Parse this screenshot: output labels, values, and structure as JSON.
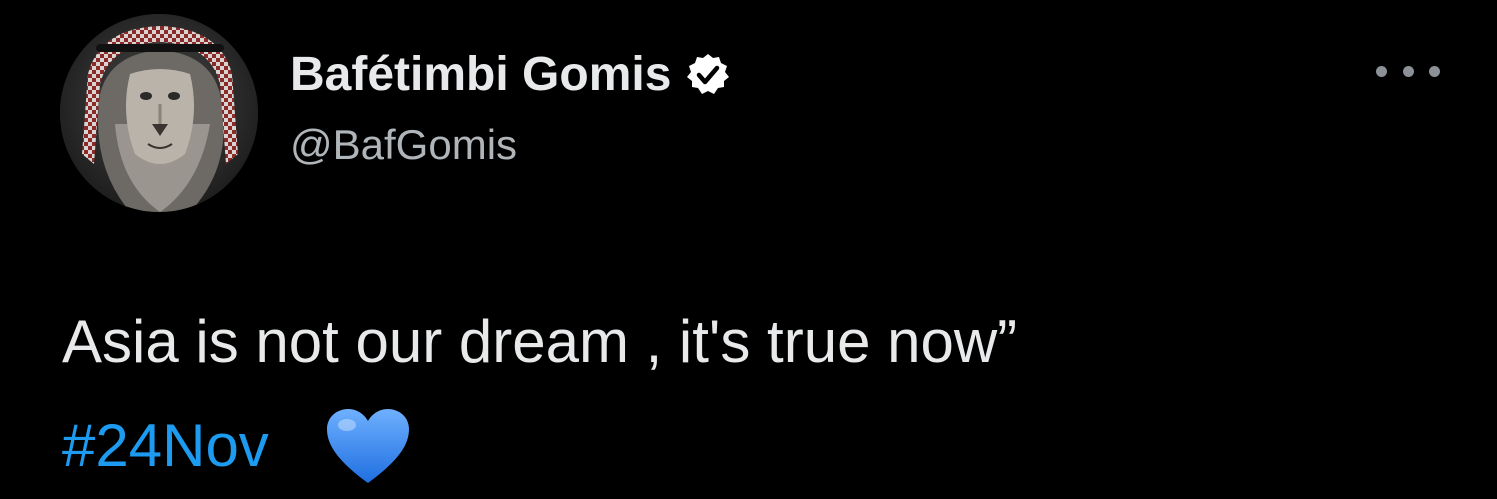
{
  "author": {
    "display_name": "Bafétimbi Gomis",
    "handle": "@BafGomis",
    "verified": true,
    "avatar_icon": "lion-avatar-icon"
  },
  "menu": {
    "icon": "more-horizontal-icon"
  },
  "tweet": {
    "text": "Asia is not our dream , it's true now”",
    "hashtag": "#24Nov",
    "emoji": "blue-heart-icon"
  },
  "colors": {
    "background": "#000000",
    "text": "#e7e9ea",
    "secondary_text": "#b0b5ba",
    "hashtag": "#1d9bf0",
    "heart": "#3a8ef0"
  }
}
